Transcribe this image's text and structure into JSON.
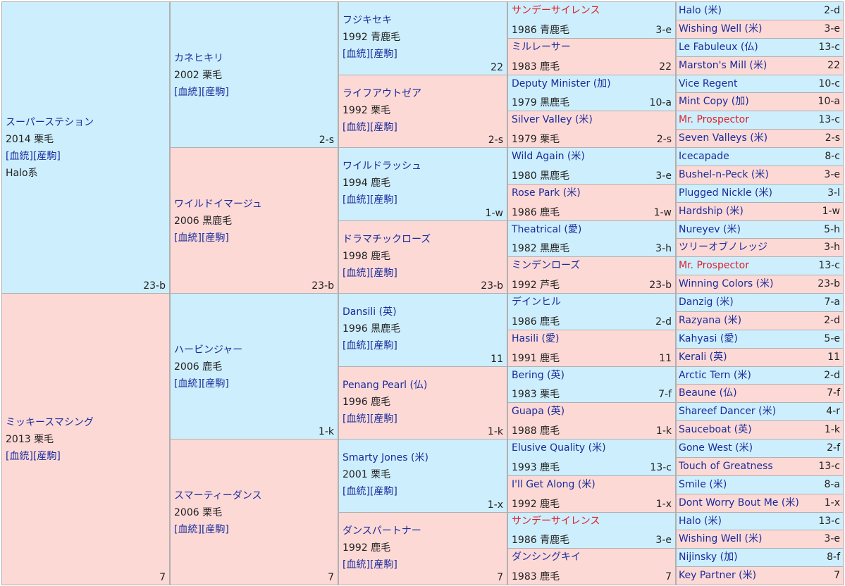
{
  "links": {
    "blood": "[血統]",
    "prog": "[産駒]"
  },
  "g1": [
    {
      "name": "スーパーステション",
      "year": "2014",
      "color": "栗毛",
      "family": "23-b",
      "line": "Halo系",
      "sex": "m"
    },
    {
      "name": "ミッキースマシング",
      "year": "2013",
      "color": "栗毛",
      "family": "7",
      "line": "",
      "sex": "f"
    }
  ],
  "g2": [
    {
      "name": "カネヒキリ",
      "year": "2002",
      "color": "栗毛",
      "family": "2-s",
      "sex": "m"
    },
    {
      "name": "ワイルドイマージュ",
      "year": "2006",
      "color": "黒鹿毛",
      "family": "23-b",
      "sex": "f"
    },
    {
      "name": "ハービンジャー",
      "year": "2006",
      "color": "鹿毛",
      "family": "1-k",
      "sex": "m"
    },
    {
      "name": "スマーティーダンス",
      "year": "2006",
      "color": "栗毛",
      "family": "7",
      "sex": "f"
    }
  ],
  "g3": [
    {
      "name": "フジキセキ",
      "year": "1992",
      "color": "青鹿毛",
      "family": "22",
      "sex": "m"
    },
    {
      "name": "ライフアウトゼア",
      "year": "1992",
      "color": "栗毛",
      "family": "2-s",
      "sex": "f"
    },
    {
      "name": "ワイルドラッシュ",
      "year": "1994",
      "color": "鹿毛",
      "family": "1-w",
      "sex": "m"
    },
    {
      "name": "ドラマチックローズ",
      "year": "1998",
      "color": "鹿毛",
      "family": "23-b",
      "sex": "f"
    },
    {
      "name": "Dansili (英)",
      "year": "1996",
      "color": "黒鹿毛",
      "family": "11",
      "sex": "m"
    },
    {
      "name": "Penang Pearl (仏)",
      "year": "1996",
      "color": "鹿毛",
      "family": "1-k",
      "sex": "f"
    },
    {
      "name": "Smarty Jones (米)",
      "year": "2001",
      "color": "栗毛",
      "family": "1-x",
      "sex": "m"
    },
    {
      "name": "ダンスパートナー",
      "year": "1992",
      "color": "鹿毛",
      "family": "7",
      "sex": "f"
    }
  ],
  "g4": [
    {
      "name": "サンデーサイレンス",
      "year": "1986",
      "color": "青鹿毛",
      "family": "3-e",
      "sex": "m",
      "red": true
    },
    {
      "name": "ミルレーサー",
      "year": "1983",
      "color": "鹿毛",
      "family": "22",
      "sex": "f"
    },
    {
      "name": "Deputy Minister (加)",
      "year": "1979",
      "color": "黒鹿毛",
      "family": "10-a",
      "sex": "m"
    },
    {
      "name": "Silver Valley (米)",
      "year": "1979",
      "color": "栗毛",
      "family": "2-s",
      "sex": "f"
    },
    {
      "name": "Wild Again (米)",
      "year": "1980",
      "color": "黒鹿毛",
      "family": "3-e",
      "sex": "m"
    },
    {
      "name": "Rose Park (米)",
      "year": "1986",
      "color": "鹿毛",
      "family": "1-w",
      "sex": "f"
    },
    {
      "name": "Theatrical (愛)",
      "year": "1982",
      "color": "黒鹿毛",
      "family": "3-h",
      "sex": "m"
    },
    {
      "name": "ミンデンローズ",
      "year": "1992",
      "color": "芦毛",
      "family": "23-b",
      "sex": "f"
    },
    {
      "name": "デインヒル",
      "year": "1986",
      "color": "鹿毛",
      "family": "2-d",
      "sex": "m"
    },
    {
      "name": "Hasili (愛)",
      "year": "1991",
      "color": "鹿毛",
      "family": "11",
      "sex": "f"
    },
    {
      "name": "Bering (英)",
      "year": "1983",
      "color": "栗毛",
      "family": "7-f",
      "sex": "m"
    },
    {
      "name": "Guapa (英)",
      "year": "1988",
      "color": "鹿毛",
      "family": "1-k",
      "sex": "f"
    },
    {
      "name": "Elusive Quality (米)",
      "year": "1993",
      "color": "鹿毛",
      "family": "13-c",
      "sex": "m"
    },
    {
      "name": "I'll Get Along (米)",
      "year": "1992",
      "color": "鹿毛",
      "family": "1-x",
      "sex": "f"
    },
    {
      "name": "サンデーサイレンス",
      "year": "1986",
      "color": "青鹿毛",
      "family": "3-e",
      "sex": "m",
      "red": true
    },
    {
      "name": "ダンシングキイ",
      "year": "1983",
      "color": "鹿毛",
      "family": "7",
      "sex": "f"
    }
  ],
  "g5": [
    {
      "name": "Halo (米)",
      "family": "2-d",
      "sex": "m"
    },
    {
      "name": "Wishing Well (米)",
      "family": "3-e",
      "sex": "f"
    },
    {
      "name": "Le Fabuleux (仏)",
      "family": "13-c",
      "sex": "m"
    },
    {
      "name": "Marston's Mill (米)",
      "family": "22",
      "sex": "f"
    },
    {
      "name": "Vice Regent",
      "family": "10-c",
      "sex": "m"
    },
    {
      "name": "Mint Copy (加)",
      "family": "10-a",
      "sex": "f"
    },
    {
      "name": "Mr. Prospector",
      "family": "13-c",
      "sex": "m",
      "red": true
    },
    {
      "name": "Seven Valleys (米)",
      "family": "2-s",
      "sex": "f"
    },
    {
      "name": "Icecapade",
      "family": "8-c",
      "sex": "m"
    },
    {
      "name": "Bushel-n-Peck (米)",
      "family": "3-e",
      "sex": "f"
    },
    {
      "name": "Plugged Nickle (米)",
      "family": "3-l",
      "sex": "m"
    },
    {
      "name": "Hardship (米)",
      "family": "1-w",
      "sex": "f"
    },
    {
      "name": "Nureyev (米)",
      "family": "5-h",
      "sex": "m"
    },
    {
      "name": "ツリーオブノレッジ",
      "family": "3-h",
      "sex": "f"
    },
    {
      "name": "Mr. Prospector",
      "family": "13-c",
      "sex": "m",
      "red": true
    },
    {
      "name": "Winning Colors (米)",
      "family": "23-b",
      "sex": "f"
    },
    {
      "name": "Danzig (米)",
      "family": "7-a",
      "sex": "m"
    },
    {
      "name": "Razyana (米)",
      "family": "2-d",
      "sex": "f"
    },
    {
      "name": "Kahyasi (愛)",
      "family": "5-e",
      "sex": "m"
    },
    {
      "name": "Kerali (英)",
      "family": "11",
      "sex": "f"
    },
    {
      "name": "Arctic Tern (米)",
      "family": "2-d",
      "sex": "m"
    },
    {
      "name": "Beaune (仏)",
      "family": "7-f",
      "sex": "f"
    },
    {
      "name": "Shareef Dancer (米)",
      "family": "4-r",
      "sex": "m"
    },
    {
      "name": "Sauceboat (英)",
      "family": "1-k",
      "sex": "f"
    },
    {
      "name": "Gone West (米)",
      "family": "2-f",
      "sex": "m"
    },
    {
      "name": "Touch of Greatness",
      "family": "13-c",
      "sex": "f"
    },
    {
      "name": "Smile (米)",
      "family": "8-a",
      "sex": "m"
    },
    {
      "name": "Dont Worry Bout Me (米)",
      "family": "1-x",
      "sex": "f"
    },
    {
      "name": "Halo (米)",
      "family": "13-c",
      "sex": "m"
    },
    {
      "name": "Wishing Well (米)",
      "family": "3-e",
      "sex": "f"
    },
    {
      "name": "Nijinsky (加)",
      "family": "8-f",
      "sex": "m"
    },
    {
      "name": "Key Partner (米)",
      "family": "7",
      "sex": "f"
    }
  ]
}
